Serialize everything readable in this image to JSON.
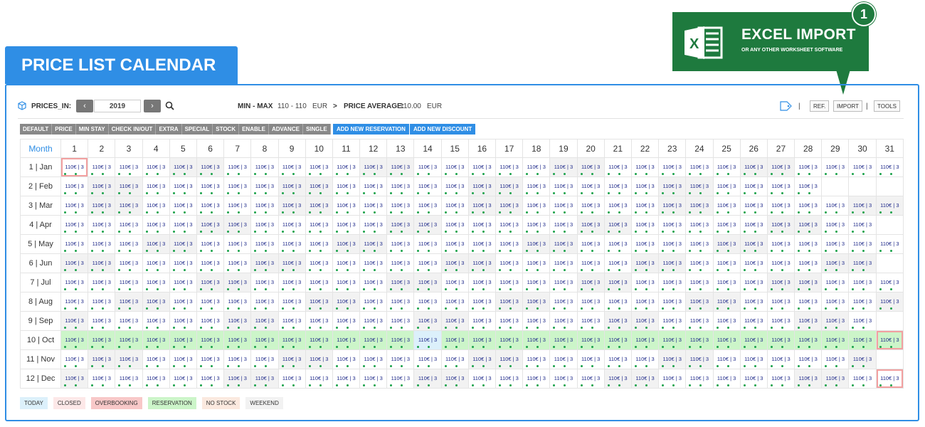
{
  "title": "PRICE LIST CALENDAR",
  "excel": {
    "title": "EXCEL IMPORT",
    "subtitle": "OR ANY OTHER WORKSHEET SOFTWARE",
    "badge": "1",
    "icon": "excel-icon",
    "color": "#1e7a3e"
  },
  "toolbar": {
    "prices_in_label": "PRICES_IN:",
    "prev": "‹",
    "year": "2019",
    "next": "›",
    "min_max_label": "MIN - MAX",
    "min_max_value": "110 - 110",
    "currency1": "EUR",
    "arrow": ">",
    "avg_label": "PRICE AVERAGE:",
    "avg_value": "110.00",
    "currency2": "EUR",
    "sep1": "|",
    "ref": "REF.",
    "import": "IMPORT",
    "sep2": "|",
    "tools": "TOOLS"
  },
  "tabs": [
    "DEFAULT",
    "PRICE",
    "MIN STAY",
    "CHECK IN/OUT",
    "EXTRA",
    "SPECIAL",
    "STOCK",
    "ENABLE",
    "ADVANCE",
    "SINGLE"
  ],
  "actions": {
    "add_reservation": "ADD NEW RESERVATION",
    "add_discount": "ADD NEW DISCOUNT"
  },
  "grid": {
    "month_header": "Month",
    "cell_value": "110€ | 3",
    "months": [
      "1 | Jan",
      "2 | Feb",
      "3 | Mar",
      "4 | Apr",
      "5 | May",
      "6 | Jun",
      "7 | Jul",
      "8 | Aug",
      "9 | Sep",
      "10 | Oct",
      "11 | Nov",
      "12 | Dec"
    ],
    "days_in_month": [
      31,
      28,
      31,
      30,
      31,
      30,
      31,
      31,
      30,
      31,
      30,
      31
    ],
    "year": 2019
  },
  "legend": [
    {
      "label": "TODAY",
      "color": "#dcf0fb"
    },
    {
      "label": "CLOSED",
      "color": "#fde8e8"
    },
    {
      "label": "OVERBOOKING",
      "color": "#f8c8c8"
    },
    {
      "label": "RESERVATION",
      "color": "#ccf5c9"
    },
    {
      "label": "NO STOCK",
      "color": "#fbe9df"
    },
    {
      "label": "WEEKEND",
      "color": "#f2f2f2"
    }
  ]
}
